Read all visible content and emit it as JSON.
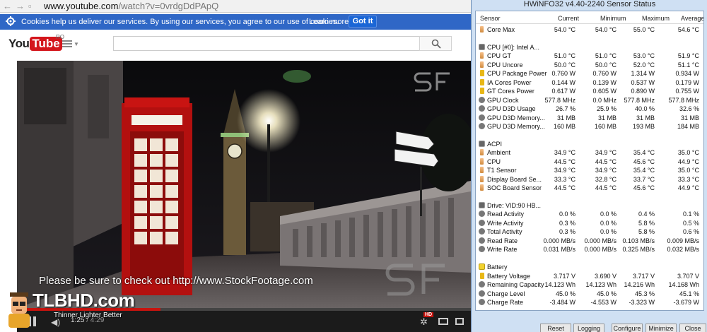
{
  "browser": {
    "url_host": "www.youtube.com",
    "url_path": "/watch?v=0vrdgDdPApQ",
    "cookie_text": "Cookies help us deliver our services. By using our services, you agree to our use of cookies.",
    "learn_more": "Learn more",
    "got_it": "Got it",
    "logo_you": "You",
    "logo_tube": "Tube",
    "logo_region": "RO"
  },
  "video": {
    "caption": "Please be sure to check out http://www.StockFootage.com",
    "time_current": "1:25",
    "time_duration": " / 4:29",
    "progress_fraction": 0.316,
    "hd_badge": "HD"
  },
  "watermark": {
    "title": "TLBHD.com",
    "subtitle": "Thinner Lighter Better"
  },
  "hwinfo": {
    "title": "HWiNFO32 v4.40-2240 Sensor Status",
    "columns": [
      "Sensor",
      "Current",
      "Minimum",
      "Maximum",
      "Average"
    ],
    "rows": [
      {
        "type": "sensor",
        "icon": "temp",
        "name": "Core Max",
        "cur": "54.0 °C",
        "min": "54.0 °C",
        "max": "55.0 °C",
        "avg": "54.6 °C"
      },
      {
        "type": "blank"
      },
      {
        "type": "group",
        "icon": "chip",
        "name": "CPU [#0]: Intel A..."
      },
      {
        "type": "sensor",
        "icon": "temp",
        "name": "CPU GT",
        "cur": "51.0 °C",
        "min": "51.0 °C",
        "max": "53.0 °C",
        "avg": "51.9 °C"
      },
      {
        "type": "sensor",
        "icon": "temp",
        "name": "CPU Uncore",
        "cur": "50.0 °C",
        "min": "50.0 °C",
        "max": "52.0 °C",
        "avg": "51.1 °C"
      },
      {
        "type": "sensor",
        "icon": "bolt",
        "name": "CPU Package Power",
        "cur": "0.760 W",
        "min": "0.760 W",
        "max": "1.314 W",
        "avg": "0.934 W"
      },
      {
        "type": "sensor",
        "icon": "bolt",
        "name": "IA Cores Power",
        "cur": "0.144 W",
        "min": "0.139 W",
        "max": "0.537 W",
        "avg": "0.179 W"
      },
      {
        "type": "sensor",
        "icon": "bolt",
        "name": "GT Cores Power",
        "cur": "0.617 W",
        "min": "0.605 W",
        "max": "0.890 W",
        "avg": "0.755 W"
      },
      {
        "type": "sensor",
        "icon": "gauge",
        "name": "GPU Clock",
        "cur": "577.8 MHz",
        "min": "0.0 MHz",
        "max": "577.8 MHz",
        "avg": "577.8 MHz"
      },
      {
        "type": "sensor",
        "icon": "gauge",
        "name": "GPU D3D Usage",
        "cur": "26.7 %",
        "min": "25.9 %",
        "max": "40.0 %",
        "avg": "32.6 %"
      },
      {
        "type": "sensor",
        "icon": "gauge",
        "name": "GPU D3D Memory...",
        "cur": "31 MB",
        "min": "31 MB",
        "max": "31 MB",
        "avg": "31 MB"
      },
      {
        "type": "sensor",
        "icon": "gauge",
        "name": "GPU D3D Memory...",
        "cur": "160 MB",
        "min": "160 MB",
        "max": "193 MB",
        "avg": "184 MB"
      },
      {
        "type": "blank"
      },
      {
        "type": "group",
        "icon": "chip",
        "name": "ACPI"
      },
      {
        "type": "sensor",
        "icon": "temp",
        "name": "Ambient",
        "cur": "34.9 °C",
        "min": "34.9 °C",
        "max": "35.4 °C",
        "avg": "35.0 °C"
      },
      {
        "type": "sensor",
        "icon": "temp",
        "name": "CPU",
        "cur": "44.5 °C",
        "min": "44.5 °C",
        "max": "45.6 °C",
        "avg": "44.9 °C"
      },
      {
        "type": "sensor",
        "icon": "temp",
        "name": "T1 Sensor",
        "cur": "34.9 °C",
        "min": "34.9 °C",
        "max": "35.4 °C",
        "avg": "35.0 °C"
      },
      {
        "type": "sensor",
        "icon": "temp",
        "name": "Display Board Se...",
        "cur": "33.3 °C",
        "min": "32.8 °C",
        "max": "33.7 °C",
        "avg": "33.3 °C"
      },
      {
        "type": "sensor",
        "icon": "temp",
        "name": "SOC Board Sensor",
        "cur": "44.5 °C",
        "min": "44.5 °C",
        "max": "45.6 °C",
        "avg": "44.9 °C"
      },
      {
        "type": "blank"
      },
      {
        "type": "group",
        "icon": "chip",
        "name": "Drive: VID:90 HB..."
      },
      {
        "type": "sensor",
        "icon": "gauge",
        "name": "Read Activity",
        "cur": "0.0 %",
        "min": "0.0 %",
        "max": "0.4 %",
        "avg": "0.1 %"
      },
      {
        "type": "sensor",
        "icon": "gauge",
        "name": "Write Activity",
        "cur": "0.3 %",
        "min": "0.0 %",
        "max": "5.8 %",
        "avg": "0.5 %"
      },
      {
        "type": "sensor",
        "icon": "gauge",
        "name": "Total Activity",
        "cur": "0.3 %",
        "min": "0.0 %",
        "max": "5.8 %",
        "avg": "0.6 %"
      },
      {
        "type": "sensor",
        "icon": "gauge",
        "name": "Read Rate",
        "cur": "0.000 MB/s",
        "min": "0.000 MB/s",
        "max": "0.103 MB/s",
        "avg": "0.009 MB/s"
      },
      {
        "type": "sensor",
        "icon": "gauge",
        "name": "Write Rate",
        "cur": "0.031 MB/s",
        "min": "0.000 MB/s",
        "max": "0.325 MB/s",
        "avg": "0.032 MB/s"
      },
      {
        "type": "blank"
      },
      {
        "type": "group",
        "icon": "bat",
        "name": "Battery"
      },
      {
        "type": "sensor",
        "icon": "bolt",
        "name": "Battery Voltage",
        "cur": "3.717 V",
        "min": "3.690 V",
        "max": "3.717 V",
        "avg": "3.707 V"
      },
      {
        "type": "sensor",
        "icon": "gauge",
        "name": "Remaining Capacity",
        "cur": "14.123 Wh",
        "min": "14.123 Wh",
        "max": "14.216 Wh",
        "avg": "14.168 Wh"
      },
      {
        "type": "sensor",
        "icon": "gauge",
        "name": "Charge Level",
        "cur": "45.0 %",
        "min": "45.0 %",
        "max": "45.3 %",
        "avg": "45.1 %"
      },
      {
        "type": "sensor",
        "icon": "gauge",
        "name": "Charge Rate",
        "cur": "-3.484 W",
        "min": "-4.553 W",
        "max": "-3.323 W",
        "avg": "-3.679 W"
      }
    ],
    "buttons": [
      "Reset",
      "Logging",
      "Configure",
      "Minimize",
      "Close"
    ]
  },
  "colors": {
    "cookie_bar": "#2f67c6",
    "youtube_red": "#d4161c",
    "progress_red": "#c7140f",
    "hwinfo_frame": "#cfe0f3"
  }
}
